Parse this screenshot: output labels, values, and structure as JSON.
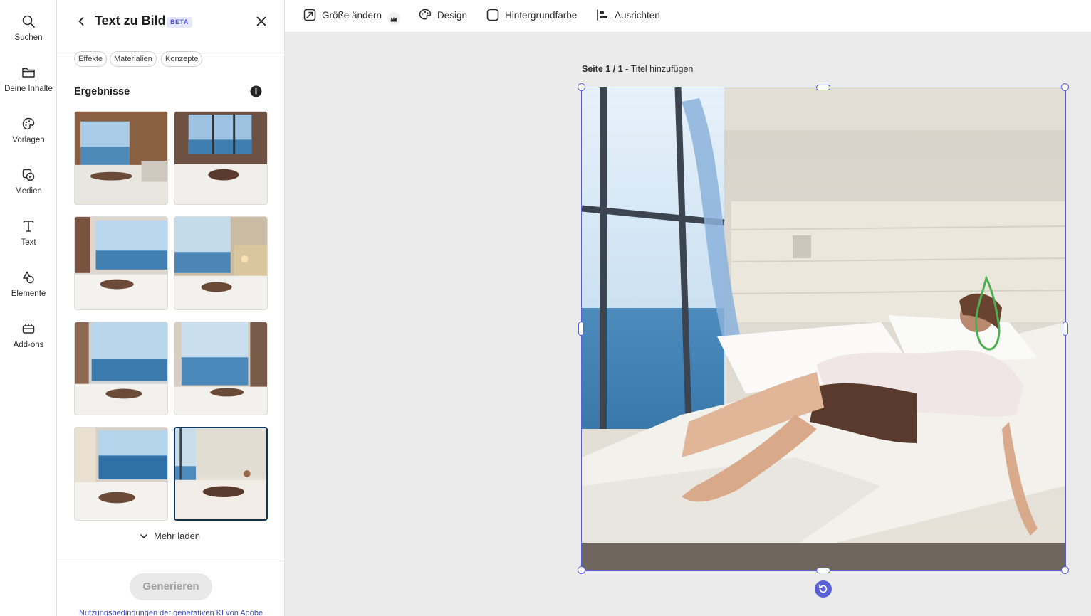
{
  "rail": {
    "items": [
      {
        "label": "Suchen",
        "icon": "search-icon"
      },
      {
        "label": "Deine Inhalte",
        "icon": "folder-icon"
      },
      {
        "label": "Vorlagen",
        "icon": "templates-icon"
      },
      {
        "label": "Medien",
        "icon": "media-icon"
      },
      {
        "label": "Text",
        "icon": "text-icon"
      },
      {
        "label": "Elemente",
        "icon": "elements-icon"
      },
      {
        "label": "Add-ons",
        "icon": "addons-icon"
      }
    ]
  },
  "panel": {
    "title": "Text zu Bild",
    "badge": "BETA",
    "chips": [
      "Effekte",
      "Materialien",
      "Konzepte"
    ],
    "results_title": "Ergebnisse",
    "more_label": "Mehr laden",
    "generate_label": "Generieren",
    "terms_label": "Nutzungsbedingungen der generativen KI von Adobe",
    "selected_index": 7
  },
  "toolbar": {
    "resize_label": "Größe ändern",
    "design_label": "Design",
    "background_label": "Hintergrundfarbe",
    "align_label": "Ausrichten"
  },
  "canvas": {
    "page_prefix": "Seite 1 / 1 -",
    "page_title_placeholder": "Titel hinzufügen"
  },
  "colors": {
    "accent": "#5a5fd6",
    "selected_border": "#0f3557",
    "link": "#3b4cc0"
  }
}
